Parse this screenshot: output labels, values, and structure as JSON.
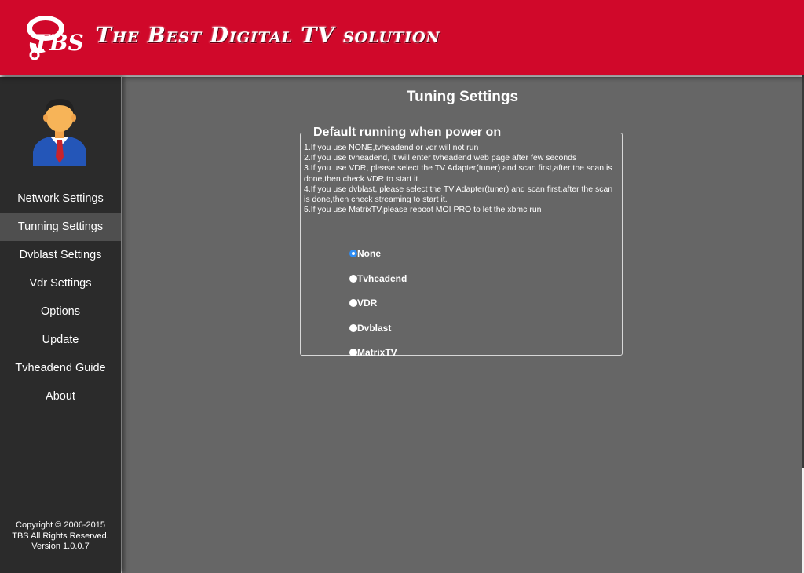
{
  "header": {
    "brand_logo_text": "TBS",
    "brand_title": "The Best Digital TV solution",
    "background_color": "#d0082a"
  },
  "sidebar": {
    "avatar_icon": "user-avatar-icon",
    "items": [
      {
        "label": "Network Settings",
        "active": false
      },
      {
        "label": "Tunning Settings",
        "active": true
      },
      {
        "label": "Dvblast Settings",
        "active": false
      },
      {
        "label": "Vdr Settings",
        "active": false
      },
      {
        "label": "Options",
        "active": false
      },
      {
        "label": "Update",
        "active": false
      },
      {
        "label": "Tvheadend Guide",
        "active": false
      },
      {
        "label": "About",
        "active": false
      }
    ],
    "footer": {
      "copyright": "Copyright © 2006-2015",
      "rights": "TBS All Rights Reserved.",
      "version": "Version 1.0.0.7"
    }
  },
  "main": {
    "title": "Tuning Settings",
    "panel": {
      "legend": "Default running when power on",
      "instructions": [
        "1.If you use NONE,tvheadend or vdr will not run",
        "2.If you use tvheadend, it will enter tvheadend web page after few seconds",
        "3.If you use VDR, please select the TV Adapter(tuner) and scan first,after the scan is done,then check VDR to start it.",
        "4.If you use dvblast, please select the TV Adapter(tuner) and scan first,after the scan is done,then check streaming to start it.",
        "5.If you use MatrixTV,please reboot MOI PRO to let the xbmc run"
      ],
      "options": [
        {
          "label": "None",
          "selected": true
        },
        {
          "label": "Tvheadend",
          "selected": false
        },
        {
          "label": "VDR",
          "selected": false
        },
        {
          "label": "Dvblast",
          "selected": false
        },
        {
          "label": "MatrixTV",
          "selected": false
        }
      ],
      "selected_color": "#2f8ef5"
    }
  }
}
